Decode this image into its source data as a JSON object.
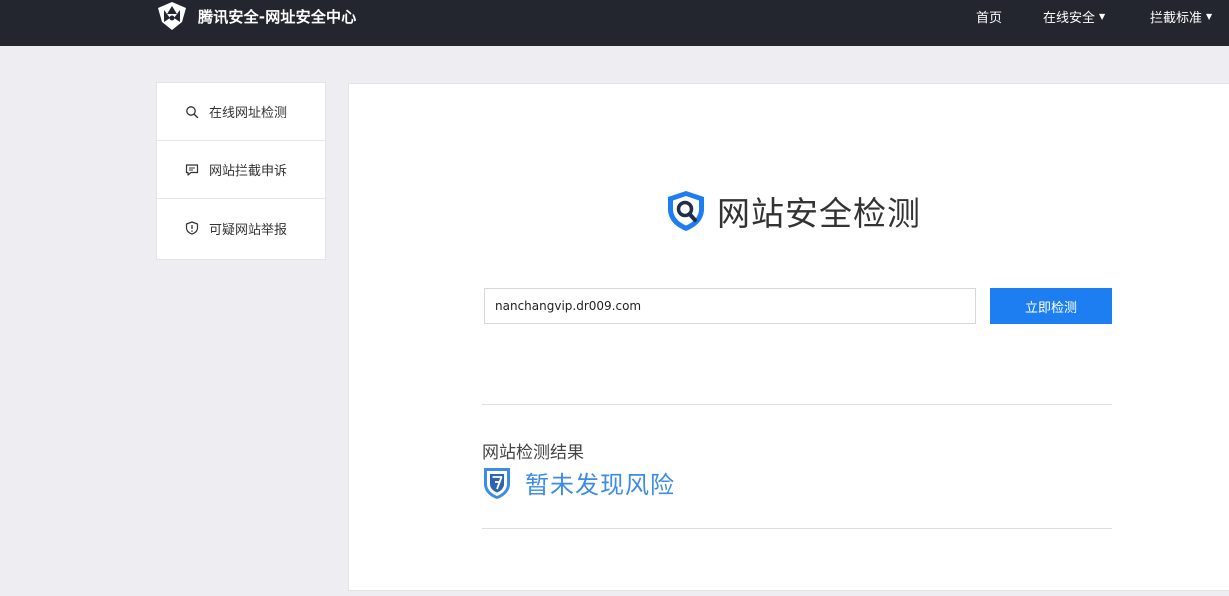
{
  "header": {
    "brand_title": "腾讯安全-网址安全中心",
    "nav": [
      {
        "label": "首页",
        "has_dropdown": false
      },
      {
        "label": "在线安全",
        "has_dropdown": true
      },
      {
        "label": "拦截标准",
        "has_dropdown": true
      }
    ],
    "caret": "▼"
  },
  "sidebar": {
    "items": [
      {
        "label": "在线网址检测",
        "icon": "search-icon"
      },
      {
        "label": "网站拦截申诉",
        "icon": "comment-icon"
      },
      {
        "label": "可疑网站举报",
        "icon": "shield-alert-icon"
      }
    ]
  },
  "main": {
    "hero_title": "网站安全检测",
    "url_value": "nanchangvip.dr009.com",
    "check_button": "立即检测",
    "result_label": "网站检测结果",
    "result_status": "暂未发现风险"
  },
  "colors": {
    "header_bg": "#24262f",
    "accent": "#1c7ef0",
    "result_text": "#3c8be8",
    "page_bg": "#eeeef2"
  }
}
